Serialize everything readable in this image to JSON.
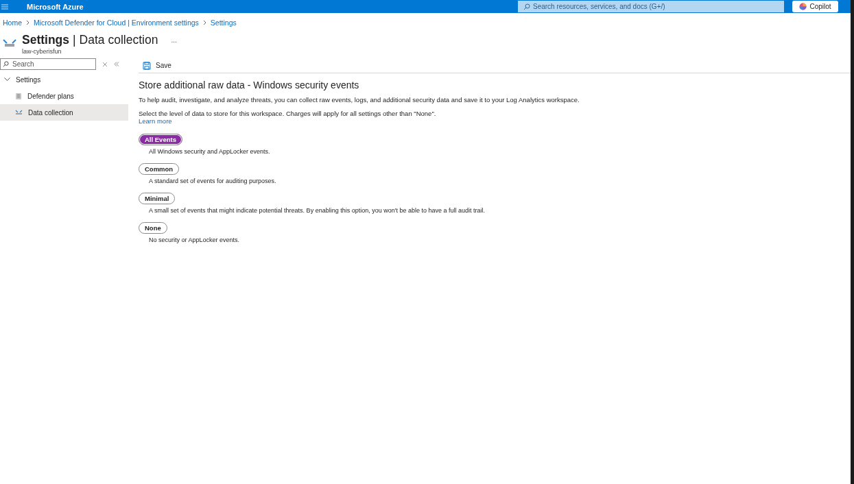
{
  "topbar": {
    "brand": "Microsoft Azure",
    "search_placeholder": "Search resources, services, and docs (G+/)",
    "copilot": "Copilot"
  },
  "breadcrumb": [
    "Home",
    "Microsoft Defender for Cloud | Environment settings",
    "Settings"
  ],
  "header": {
    "title_bold": "Settings",
    "separator": "|",
    "title_rest": "Data collection",
    "more": "...",
    "subtitle": "law-cyberisfun"
  },
  "sidebar": {
    "search_placeholder": "Search",
    "items": [
      {
        "label": "Settings",
        "expanded": true,
        "selected": false,
        "children": [
          {
            "label": "Defender plans",
            "kind": "plans",
            "selected": false
          },
          {
            "label": "Data collection",
            "kind": "collection",
            "selected": true
          }
        ]
      }
    ]
  },
  "toolbar": {
    "save": "Save"
  },
  "content": {
    "heading": "Store additional raw data - Windows security events",
    "intro": "To help audit, investigate, and analyze threats, you can collect raw events, logs, and additional security data and save it to your Log Analytics workspace.",
    "select_text": "Select the level of data to store for this workspace. Charges will apply for all settings other than \"None\".",
    "learn_more": "Learn more",
    "options": [
      {
        "label": "All Events",
        "description": "All Windows security and AppLocker events.",
        "selected": true
      },
      {
        "label": "Common",
        "description": "A standard set of events for auditing purposes.",
        "selected": false
      },
      {
        "label": "Minimal",
        "description": "A small set of events that might indicate potential threats. By enabling this option, you won't be able to have a full audit trail.",
        "selected": false
      },
      {
        "label": "None",
        "description": "No security or AppLocker events.",
        "selected": false
      }
    ]
  }
}
